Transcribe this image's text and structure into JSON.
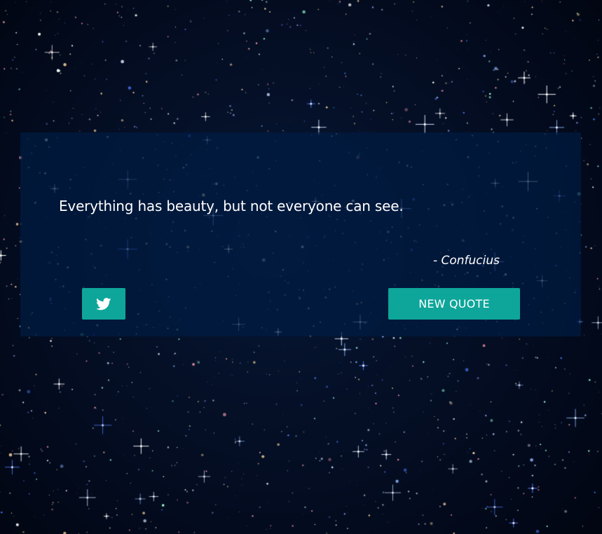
{
  "quote": {
    "text": "Everything has beauty, but not everyone can see.",
    "author": "- Confucius"
  },
  "actions": {
    "tweet_icon": "twitter-icon",
    "new_quote_label": "NEW QUOTE"
  },
  "colors": {
    "accent": "#0ea69a",
    "card_background": "#001c42",
    "page_background": "#020510"
  }
}
